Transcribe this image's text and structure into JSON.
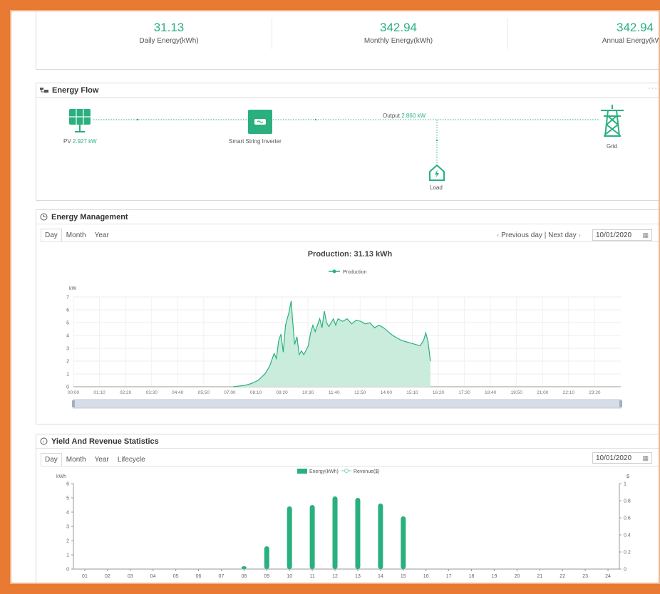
{
  "kpis": [
    {
      "value": "31.13",
      "label": "Daily Energy(kWh)"
    },
    {
      "value": "342.94",
      "label": "Monthly Energy(kWh)"
    },
    {
      "value": "342.94",
      "label": "Annual Energy(kWh)"
    }
  ],
  "energy_flow": {
    "title": "Energy Flow",
    "more": "···",
    "pv_label": "PV",
    "pv_value": "2.927 kW",
    "inverter_label": "Smart String Inverter",
    "output_label": "Output",
    "output_value": "2.860 kW",
    "load_label": "Load",
    "grid_label": "Grid"
  },
  "energy_management": {
    "title": "Energy Management",
    "tabs": [
      "Day",
      "Month",
      "Year"
    ],
    "active_tab": "Day",
    "prev_label": "Previous day",
    "sep": "|",
    "next_label": "Next day",
    "date": "10/01/2020",
    "chart_title": "Production: 31.13 kWh",
    "legend": "Production"
  },
  "yield_revenue": {
    "title": "Yield And Revenue Statistics",
    "tabs": [
      "Day",
      "Month",
      "Year",
      "Lifecycle"
    ],
    "active_tab": "Day",
    "date": "10/01/2020",
    "legend_energy": "Energy(kWh)",
    "legend_revenue": "Revenue($)"
  },
  "colors": {
    "accent": "#2ab07f",
    "area": "#c9ecdc",
    "frame": "#e87a33"
  },
  "chart_data": [
    {
      "type": "area",
      "title": "Production: 31.13 kWh",
      "ylabel": "kW",
      "ylim": [
        0,
        7
      ],
      "yticks": [
        0,
        1,
        2,
        3,
        4,
        5,
        6,
        7
      ],
      "xticks": [
        "00:00",
        "01:10",
        "02:20",
        "03:30",
        "04:40",
        "05:50",
        "07:00",
        "08:10",
        "09:20",
        "10:30",
        "11:40",
        "12:50",
        "14:00",
        "15:10",
        "16:20",
        "17:30",
        "18:40",
        "19:50",
        "21:00",
        "22:10",
        "23:20"
      ],
      "x_range_hours": [
        0,
        24
      ],
      "series": [
        {
          "name": "Production",
          "points": [
            [
              7.0,
              0
            ],
            [
              7.5,
              0.1
            ],
            [
              7.8,
              0.25
            ],
            [
              8.1,
              0.5
            ],
            [
              8.4,
              1.0
            ],
            [
              8.6,
              1.6
            ],
            [
              8.8,
              2.6
            ],
            [
              8.9,
              2.2
            ],
            [
              9.0,
              3.6
            ],
            [
              9.1,
              4.1
            ],
            [
              9.2,
              2.7
            ],
            [
              9.3,
              4.8
            ],
            [
              9.45,
              5.8
            ],
            [
              9.55,
              6.7
            ],
            [
              9.6,
              5.4
            ],
            [
              9.7,
              3.3
            ],
            [
              9.8,
              3.9
            ],
            [
              9.9,
              2.5
            ],
            [
              10.0,
              2.8
            ],
            [
              10.1,
              2.5
            ],
            [
              10.3,
              3.2
            ],
            [
              10.4,
              4.2
            ],
            [
              10.5,
              4.8
            ],
            [
              10.6,
              4.3
            ],
            [
              10.8,
              5.3
            ],
            [
              10.9,
              4.6
            ],
            [
              11.0,
              5.9
            ],
            [
              11.1,
              5.0
            ],
            [
              11.2,
              4.7
            ],
            [
              11.4,
              5.3
            ],
            [
              11.5,
              4.8
            ],
            [
              11.6,
              5.3
            ],
            [
              11.8,
              5.1
            ],
            [
              12.0,
              5.3
            ],
            [
              12.2,
              4.9
            ],
            [
              12.4,
              5.2
            ],
            [
              12.6,
              5.1
            ],
            [
              12.8,
              4.9
            ],
            [
              13.0,
              5.0
            ],
            [
              13.2,
              4.6
            ],
            [
              13.4,
              4.8
            ],
            [
              13.6,
              4.6
            ],
            [
              13.8,
              4.3
            ],
            [
              14.0,
              4.0
            ],
            [
              14.2,
              3.8
            ],
            [
              14.4,
              3.6
            ],
            [
              14.6,
              3.5
            ],
            [
              14.8,
              3.4
            ],
            [
              15.0,
              3.3
            ],
            [
              15.2,
              3.2
            ],
            [
              15.35,
              3.6
            ],
            [
              15.45,
              4.2
            ],
            [
              15.55,
              3.5
            ],
            [
              15.65,
              2.0
            ]
          ]
        }
      ]
    },
    {
      "type": "bar",
      "ylabel": "kWh",
      "ylabel_right": "$",
      "ylim": [
        0,
        6
      ],
      "yticks": [
        0,
        1,
        2,
        3,
        4,
        5,
        6
      ],
      "ylim_right": [
        0,
        1
      ],
      "yticks_right": [
        0,
        0.2,
        0.4,
        0.6,
        0.8,
        1
      ],
      "categories": [
        "01",
        "02",
        "03",
        "04",
        "05",
        "06",
        "07",
        "08",
        "09",
        "10",
        "11",
        "12",
        "13",
        "14",
        "15",
        "16",
        "17",
        "18",
        "19",
        "20",
        "21",
        "22",
        "23",
        "24"
      ],
      "series": [
        {
          "name": "Energy(kWh)",
          "values": [
            0,
            0,
            0,
            0,
            0,
            0,
            0,
            0.2,
            1.6,
            4.4,
            4.5,
            5.1,
            5.0,
            4.6,
            3.7,
            0,
            0,
            0,
            0,
            0,
            0,
            0,
            0,
            0
          ]
        },
        {
          "name": "Revenue($)",
          "values": [
            0,
            0,
            0,
            0,
            0,
            0,
            0,
            0,
            0,
            0,
            0,
            0,
            0,
            0,
            0,
            0,
            0,
            0,
            0,
            0,
            0,
            0,
            0,
            0
          ]
        }
      ]
    }
  ]
}
